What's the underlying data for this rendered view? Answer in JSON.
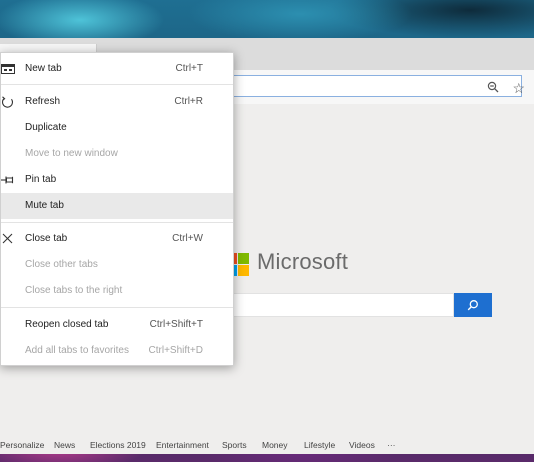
{
  "desktop": {
    "wallpaper": "abstract-smoke"
  },
  "brand": {
    "name": "Microsoft",
    "logo_colors": [
      "#f25022",
      "#7fba00",
      "#00a4ef",
      "#ffb900"
    ],
    "search_button_color": "#1e6fd0"
  },
  "toolbar": {
    "zoom_icon": "zoom-out-icon",
    "favorite_icon": "star-icon"
  },
  "context_menu": {
    "items": [
      {
        "label": "New tab",
        "shortcut": "Ctrl+T",
        "icon": "new-tab-icon",
        "enabled": true
      },
      {
        "label": "Refresh",
        "shortcut": "Ctrl+R",
        "icon": "refresh-icon",
        "enabled": true
      },
      {
        "label": "Duplicate",
        "shortcut": "",
        "icon": "",
        "enabled": true
      },
      {
        "label": "Move to new window",
        "shortcut": "",
        "icon": "",
        "enabled": false
      },
      {
        "label": "Pin tab",
        "shortcut": "",
        "icon": "pin-icon",
        "enabled": true
      },
      {
        "label": "Mute tab",
        "shortcut": "",
        "icon": "",
        "enabled": true,
        "hovered": true
      },
      {
        "label": "Close tab",
        "shortcut": "Ctrl+W",
        "icon": "close-icon",
        "enabled": true
      },
      {
        "label": "Close other tabs",
        "shortcut": "",
        "icon": "",
        "enabled": false
      },
      {
        "label": "Close tabs to the right",
        "shortcut": "",
        "icon": "",
        "enabled": false
      },
      {
        "label": "Reopen closed tab",
        "shortcut": "Ctrl+Shift+T",
        "icon": "",
        "enabled": true
      },
      {
        "label": "Add all tabs to favorites",
        "shortcut": "Ctrl+Shift+D",
        "icon": "",
        "enabled": false
      }
    ]
  },
  "news_bar": {
    "items": [
      "Personalize",
      "News",
      "Elections 2019",
      "Entertainment",
      "Sports",
      "Money",
      "Lifestyle",
      "Videos"
    ],
    "more": "···"
  }
}
